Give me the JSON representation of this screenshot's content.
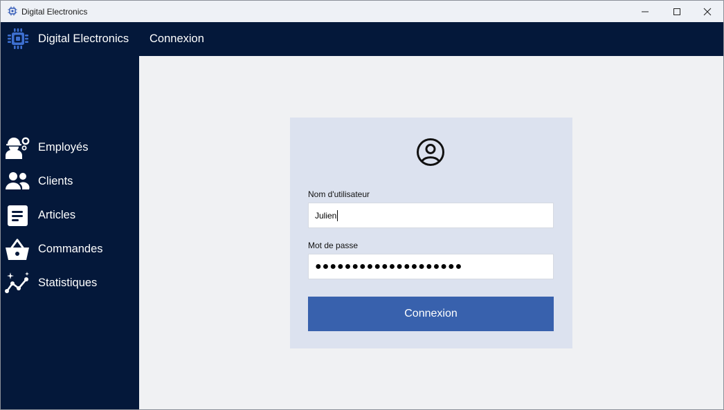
{
  "window": {
    "title": "Digital Electronics",
    "controls": [
      "minimize-icon",
      "maximize-icon",
      "close-icon"
    ]
  },
  "header": {
    "app_name": "Digital Electronics",
    "page_title": "Connexion",
    "logo_icon": "chip-icon"
  },
  "sidebar": {
    "items": [
      {
        "label": "Employés",
        "icon": "worker-gear-icon"
      },
      {
        "label": "Clients",
        "icon": "people-icon"
      },
      {
        "label": "Articles",
        "icon": "document-icon"
      },
      {
        "label": "Commandes",
        "icon": "basket-icon"
      },
      {
        "label": "Statistiques",
        "icon": "trend-sparkle-icon"
      }
    ]
  },
  "login": {
    "avatar_icon": "user-circle-icon",
    "username_label": "Nom d'utilisateur",
    "username_value": "Julien",
    "password_label": "Mot de passe",
    "password_value": "●●●●●●●●●●●●●●●●●●●●",
    "submit_label": "Connexion"
  },
  "colors": {
    "navy": "#04183a",
    "accent": "#3861ad",
    "card": "#dce2ef",
    "background": "#f0f1f3",
    "logo_blue": "#3d6fd0"
  }
}
